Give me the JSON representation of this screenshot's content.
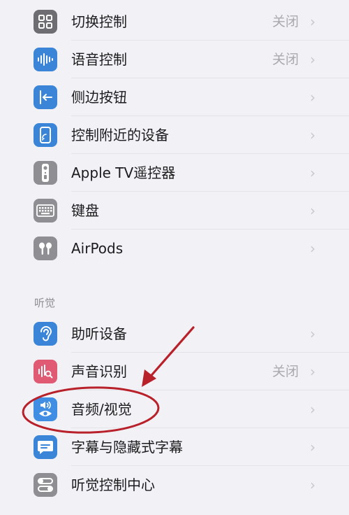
{
  "rows_top": [
    {
      "label": "切换控制",
      "value": "关闭",
      "icon": "grid-icon"
    },
    {
      "label": "语音控制",
      "value": "关闭",
      "icon": "waveform-icon"
    },
    {
      "label": "侧边按钮",
      "value": "",
      "icon": "side-button-icon"
    },
    {
      "label": "控制附近的设备",
      "value": "",
      "icon": "nearby-device-icon"
    },
    {
      "label": "Apple TV遥控器",
      "value": "",
      "icon": "remote-icon"
    },
    {
      "label": "键盘",
      "value": "",
      "icon": "keyboard-icon"
    },
    {
      "label": "AirPods",
      "value": "",
      "icon": "airpods-icon"
    }
  ],
  "hearing_section": {
    "header": "听觉",
    "rows": [
      {
        "label": "助听设备",
        "value": "",
        "icon": "ear-icon"
      },
      {
        "label": "声音识别",
        "value": "关闭",
        "icon": "sound-recognition-icon"
      },
      {
        "label": "音频/视觉",
        "value": "",
        "icon": "audio-visual-icon"
      },
      {
        "label": "字幕与隐藏式字幕",
        "value": "",
        "icon": "subtitles-icon"
      },
      {
        "label": "听觉控制中心",
        "value": "",
        "icon": "toggle-icon"
      }
    ]
  },
  "chevron": "›",
  "colors": {
    "annotation_red": "#b8202a",
    "blue_icon": "#3a85d8",
    "gray_icon": "#8e8e93",
    "pink_icon": "#e05a73"
  }
}
